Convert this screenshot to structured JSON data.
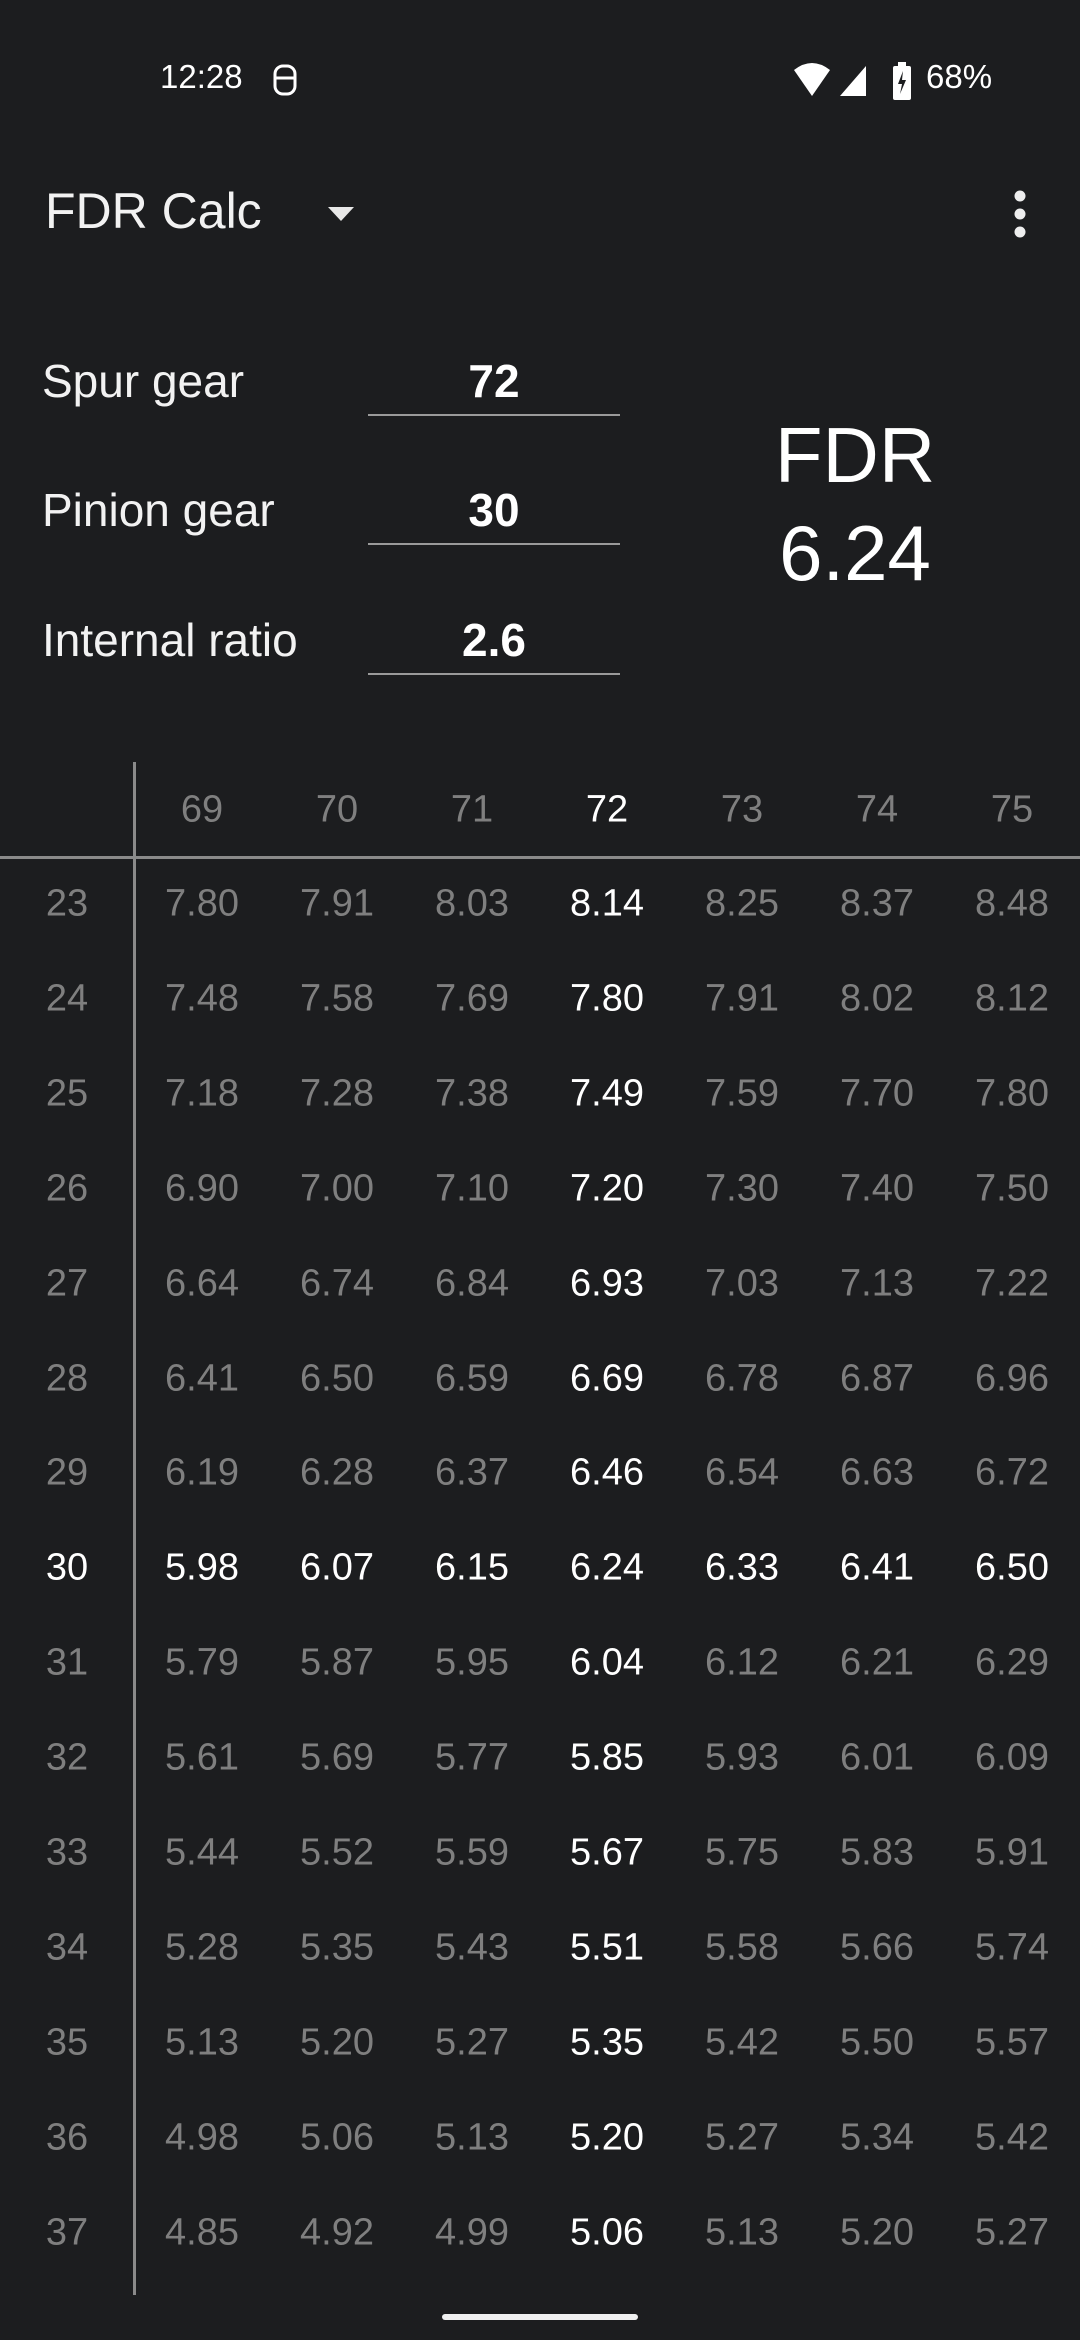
{
  "status_bar": {
    "time": "12:28",
    "battery": "68%",
    "icons": [
      "assistant-icon",
      "wifi-icon",
      "signal-icon",
      "battery-charging-icon"
    ]
  },
  "app_bar": {
    "title": "FDR Calc",
    "dropdown_icon": "arrow-drop-down-icon",
    "menu_icon": "more-vert-icon"
  },
  "inputs": [
    {
      "label": "Spur gear",
      "value": "72"
    },
    {
      "label": "Pinion gear",
      "value": "30"
    },
    {
      "label": "Internal ratio",
      "value": "2.6"
    }
  ],
  "result": {
    "label": "FDR",
    "value": "6.24"
  },
  "table": {
    "columns": [
      "69",
      "70",
      "71",
      "72",
      "73",
      "74",
      "75"
    ],
    "highlight_column": "72",
    "highlight_row": "30",
    "rows": [
      {
        "pinion": "23",
        "values": [
          "7.80",
          "7.91",
          "8.03",
          "8.14",
          "8.25",
          "8.37",
          "8.48"
        ]
      },
      {
        "pinion": "24",
        "values": [
          "7.48",
          "7.58",
          "7.69",
          "7.80",
          "7.91",
          "8.02",
          "8.12"
        ]
      },
      {
        "pinion": "25",
        "values": [
          "7.18",
          "7.28",
          "7.38",
          "7.49",
          "7.59",
          "7.70",
          "7.80"
        ]
      },
      {
        "pinion": "26",
        "values": [
          "6.90",
          "7.00",
          "7.10",
          "7.20",
          "7.30",
          "7.40",
          "7.50"
        ]
      },
      {
        "pinion": "27",
        "values": [
          "6.64",
          "6.74",
          "6.84",
          "6.93",
          "7.03",
          "7.13",
          "7.22"
        ]
      },
      {
        "pinion": "28",
        "values": [
          "6.41",
          "6.50",
          "6.59",
          "6.69",
          "6.78",
          "6.87",
          "6.96"
        ]
      },
      {
        "pinion": "29",
        "values": [
          "6.19",
          "6.28",
          "6.37",
          "6.46",
          "6.54",
          "6.63",
          "6.72"
        ]
      },
      {
        "pinion": "30",
        "values": [
          "5.98",
          "6.07",
          "6.15",
          "6.24",
          "6.33",
          "6.41",
          "6.50"
        ]
      },
      {
        "pinion": "31",
        "values": [
          "5.79",
          "5.87",
          "5.95",
          "6.04",
          "6.12",
          "6.21",
          "6.29"
        ]
      },
      {
        "pinion": "32",
        "values": [
          "5.61",
          "5.69",
          "5.77",
          "5.85",
          "5.93",
          "6.01",
          "6.09"
        ]
      },
      {
        "pinion": "33",
        "values": [
          "5.44",
          "5.52",
          "5.59",
          "5.67",
          "5.75",
          "5.83",
          "5.91"
        ]
      },
      {
        "pinion": "34",
        "values": [
          "5.28",
          "5.35",
          "5.43",
          "5.51",
          "5.58",
          "5.66",
          "5.74"
        ]
      },
      {
        "pinion": "35",
        "values": [
          "5.13",
          "5.20",
          "5.27",
          "5.35",
          "5.42",
          "5.50",
          "5.57"
        ]
      },
      {
        "pinion": "36",
        "values": [
          "4.98",
          "5.06",
          "5.13",
          "5.20",
          "5.27",
          "5.34",
          "5.42"
        ]
      },
      {
        "pinion": "37",
        "values": [
          "4.85",
          "4.92",
          "4.99",
          "5.06",
          "5.13",
          "5.20",
          "5.27"
        ]
      }
    ]
  }
}
